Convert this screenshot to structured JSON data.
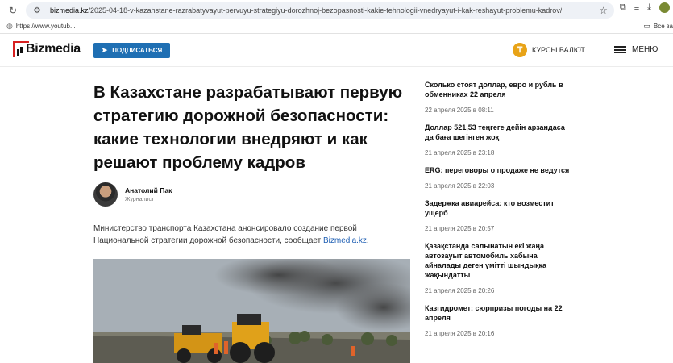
{
  "browser": {
    "url_host": "bizmedia.kz",
    "url_path": "/2025-04-18-v-kazahstane-razrabatyvayut-pervuyu-strategiyu-dorozhnoj-bezopasnosti-kakie-tehnologii-vnedryayut-i-kak-reshayut-problemu-kadrov/",
    "bookmark_label": "https://www.youtub...",
    "bookmark_folder": "Все за",
    "profile_letter": "G"
  },
  "header": {
    "logo_text": "Bizmedia",
    "subscribe_label": "ПОДПИСАТЬСЯ",
    "currency_label": "КУРСЫ ВАЛЮТ",
    "currency_icon": "₸",
    "menu_label": "МЕНЮ"
  },
  "article": {
    "title": "В Казахстане разрабатывают первую стратегию дорожной безопасности: какие технологии внедряют и как решают проблему кадров",
    "author_name": "Анатолий Пак",
    "author_role": "Журналист",
    "lead_text": "Министерство транспорта Казахстана анонсировало создание первой Национальной стратегии дорожной безопасности, сообщает ",
    "lead_link": "Bizmedia.kz",
    "lead_end": "."
  },
  "news": [
    {
      "title": "Сколько стоят доллар, евро и рубль в обменниках 22 апреля",
      "date": "22 апреля 2025 в 08:11"
    },
    {
      "title": "Доллар 521,53 теңгеге дейін арзандаса да баға шегінген жоқ",
      "date": "21 апреля 2025 в 23:18"
    },
    {
      "title": "ERG: переговоры о продаже не ведутся",
      "date": "21 апреля 2025 в 22:03"
    },
    {
      "title": "Задержка авиарейса: кто возместит ущерб",
      "date": "21 апреля 2025 в 20:57"
    },
    {
      "title": "Қазақстанда салынатын екі жаңа автозауыт автомобиль хабына айналады деген үмітті шындыққа жақындатты",
      "date": "21 апреля 2025 в 20:26"
    },
    {
      "title": "Казгидромет: сюрпризы погоды на 22 апреля",
      "date": "21 апреля 2025 в 20:16"
    }
  ]
}
